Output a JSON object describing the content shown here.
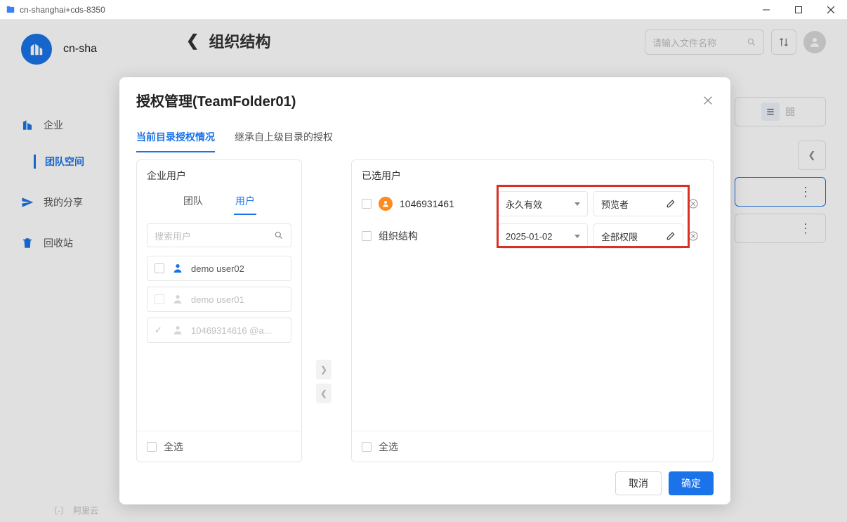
{
  "window": {
    "title": "cn-shanghai+cds-8350"
  },
  "bg": {
    "brand": "cn-sha",
    "breadcrumb": "组织结构",
    "search_placeholder": "请输入文件名称",
    "sidebar": {
      "enterprise": "企业",
      "team_space": "团队空间",
      "my_share": "我的分享",
      "recycle": "回收站"
    },
    "footer": "阿里云"
  },
  "modal": {
    "title": "授权管理(TeamFolder01)",
    "tabs": {
      "current": "当前目录授权情况",
      "inherited": "继承自上级目录的授权"
    },
    "left": {
      "title": "企业用户",
      "inner_tabs": {
        "team": "团队",
        "user": "用户"
      },
      "search_placeholder": "搜索用户",
      "users": [
        {
          "name": "demo  user02",
          "state": "normal"
        },
        {
          "name": "demo  user01",
          "state": "disabled"
        },
        {
          "name": "10469314616         @a...",
          "state": "selected"
        }
      ],
      "select_all": "全选"
    },
    "right": {
      "title": "已选用户",
      "rows": [
        {
          "name": "1046931461",
          "expiry": "永久有效",
          "role": "预览者",
          "avatar": true
        },
        {
          "name": "组织结构",
          "expiry": "2025-01-02",
          "role": "全部权限",
          "avatar": false
        }
      ],
      "select_all": "全选"
    },
    "buttons": {
      "cancel": "取消",
      "ok": "确定"
    }
  }
}
